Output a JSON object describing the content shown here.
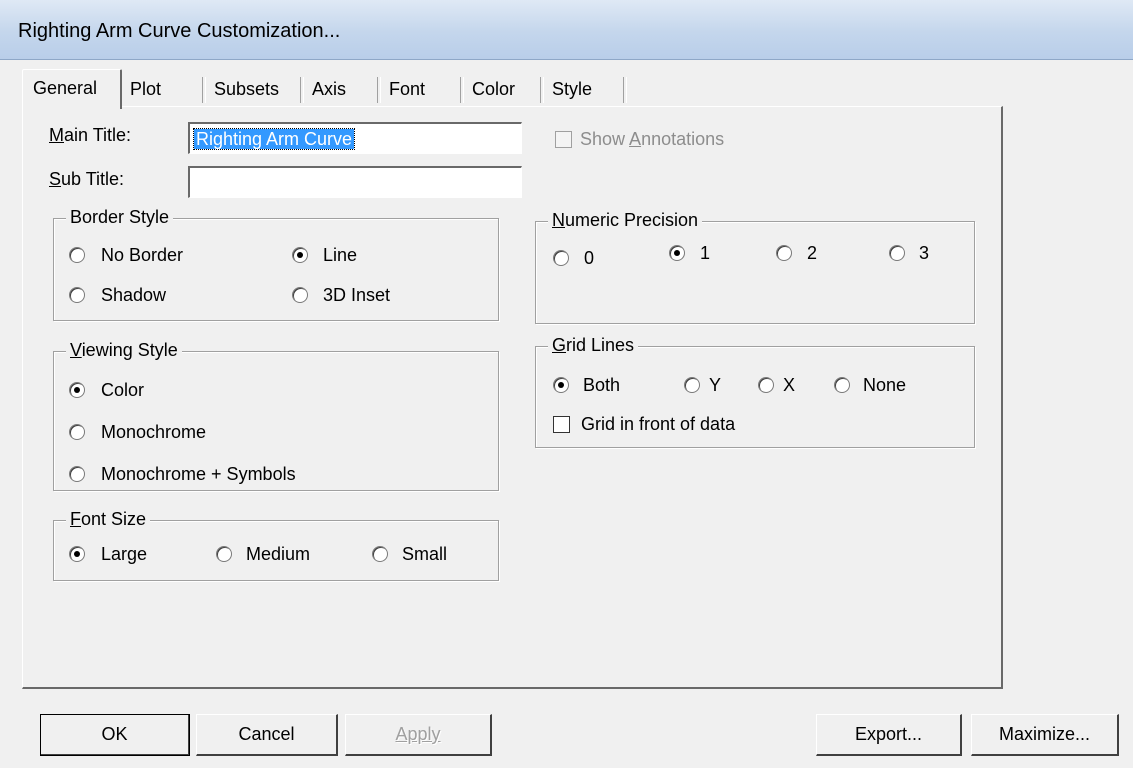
{
  "window": {
    "title": "Righting Arm Curve Customization..."
  },
  "tabs": [
    {
      "label": "General",
      "active": true
    },
    {
      "label": "Plot"
    },
    {
      "label": "Subsets"
    },
    {
      "label": "Axis"
    },
    {
      "label": "Font"
    },
    {
      "label": "Color"
    },
    {
      "label": "Style"
    }
  ],
  "general": {
    "main_title_label": "Main Title:",
    "main_title_value": "Righting Arm Curve",
    "sub_title_label": "Sub Title:",
    "sub_title_value": "",
    "show_annotations_label": "Show Annotations",
    "show_annotations_checked": false,
    "border_style": {
      "legend": "Border Style",
      "options": [
        "No Border",
        "Line",
        "Shadow",
        "3D Inset"
      ],
      "selected": "Line"
    },
    "viewing_style": {
      "legend": "Viewing Style",
      "options": [
        "Color",
        "Monochrome",
        "Monochrome + Symbols"
      ],
      "selected": "Color"
    },
    "font_size": {
      "legend": "Font Size",
      "options": [
        "Large",
        "Medium",
        "Small"
      ],
      "selected": "Large"
    },
    "numeric_precision": {
      "legend": "Numeric Precision",
      "options": [
        "0",
        "1",
        "2",
        "3"
      ],
      "selected": "1"
    },
    "grid_lines": {
      "legend": "Grid Lines",
      "options": [
        "Both",
        "Y",
        "X",
        "None"
      ],
      "selected": "Both",
      "grid_in_front_label": "Grid in front of data",
      "grid_in_front_checked": false
    }
  },
  "buttons": {
    "ok": "OK",
    "cancel": "Cancel",
    "apply": "Apply",
    "export": "Export...",
    "maximize": "Maximize..."
  }
}
